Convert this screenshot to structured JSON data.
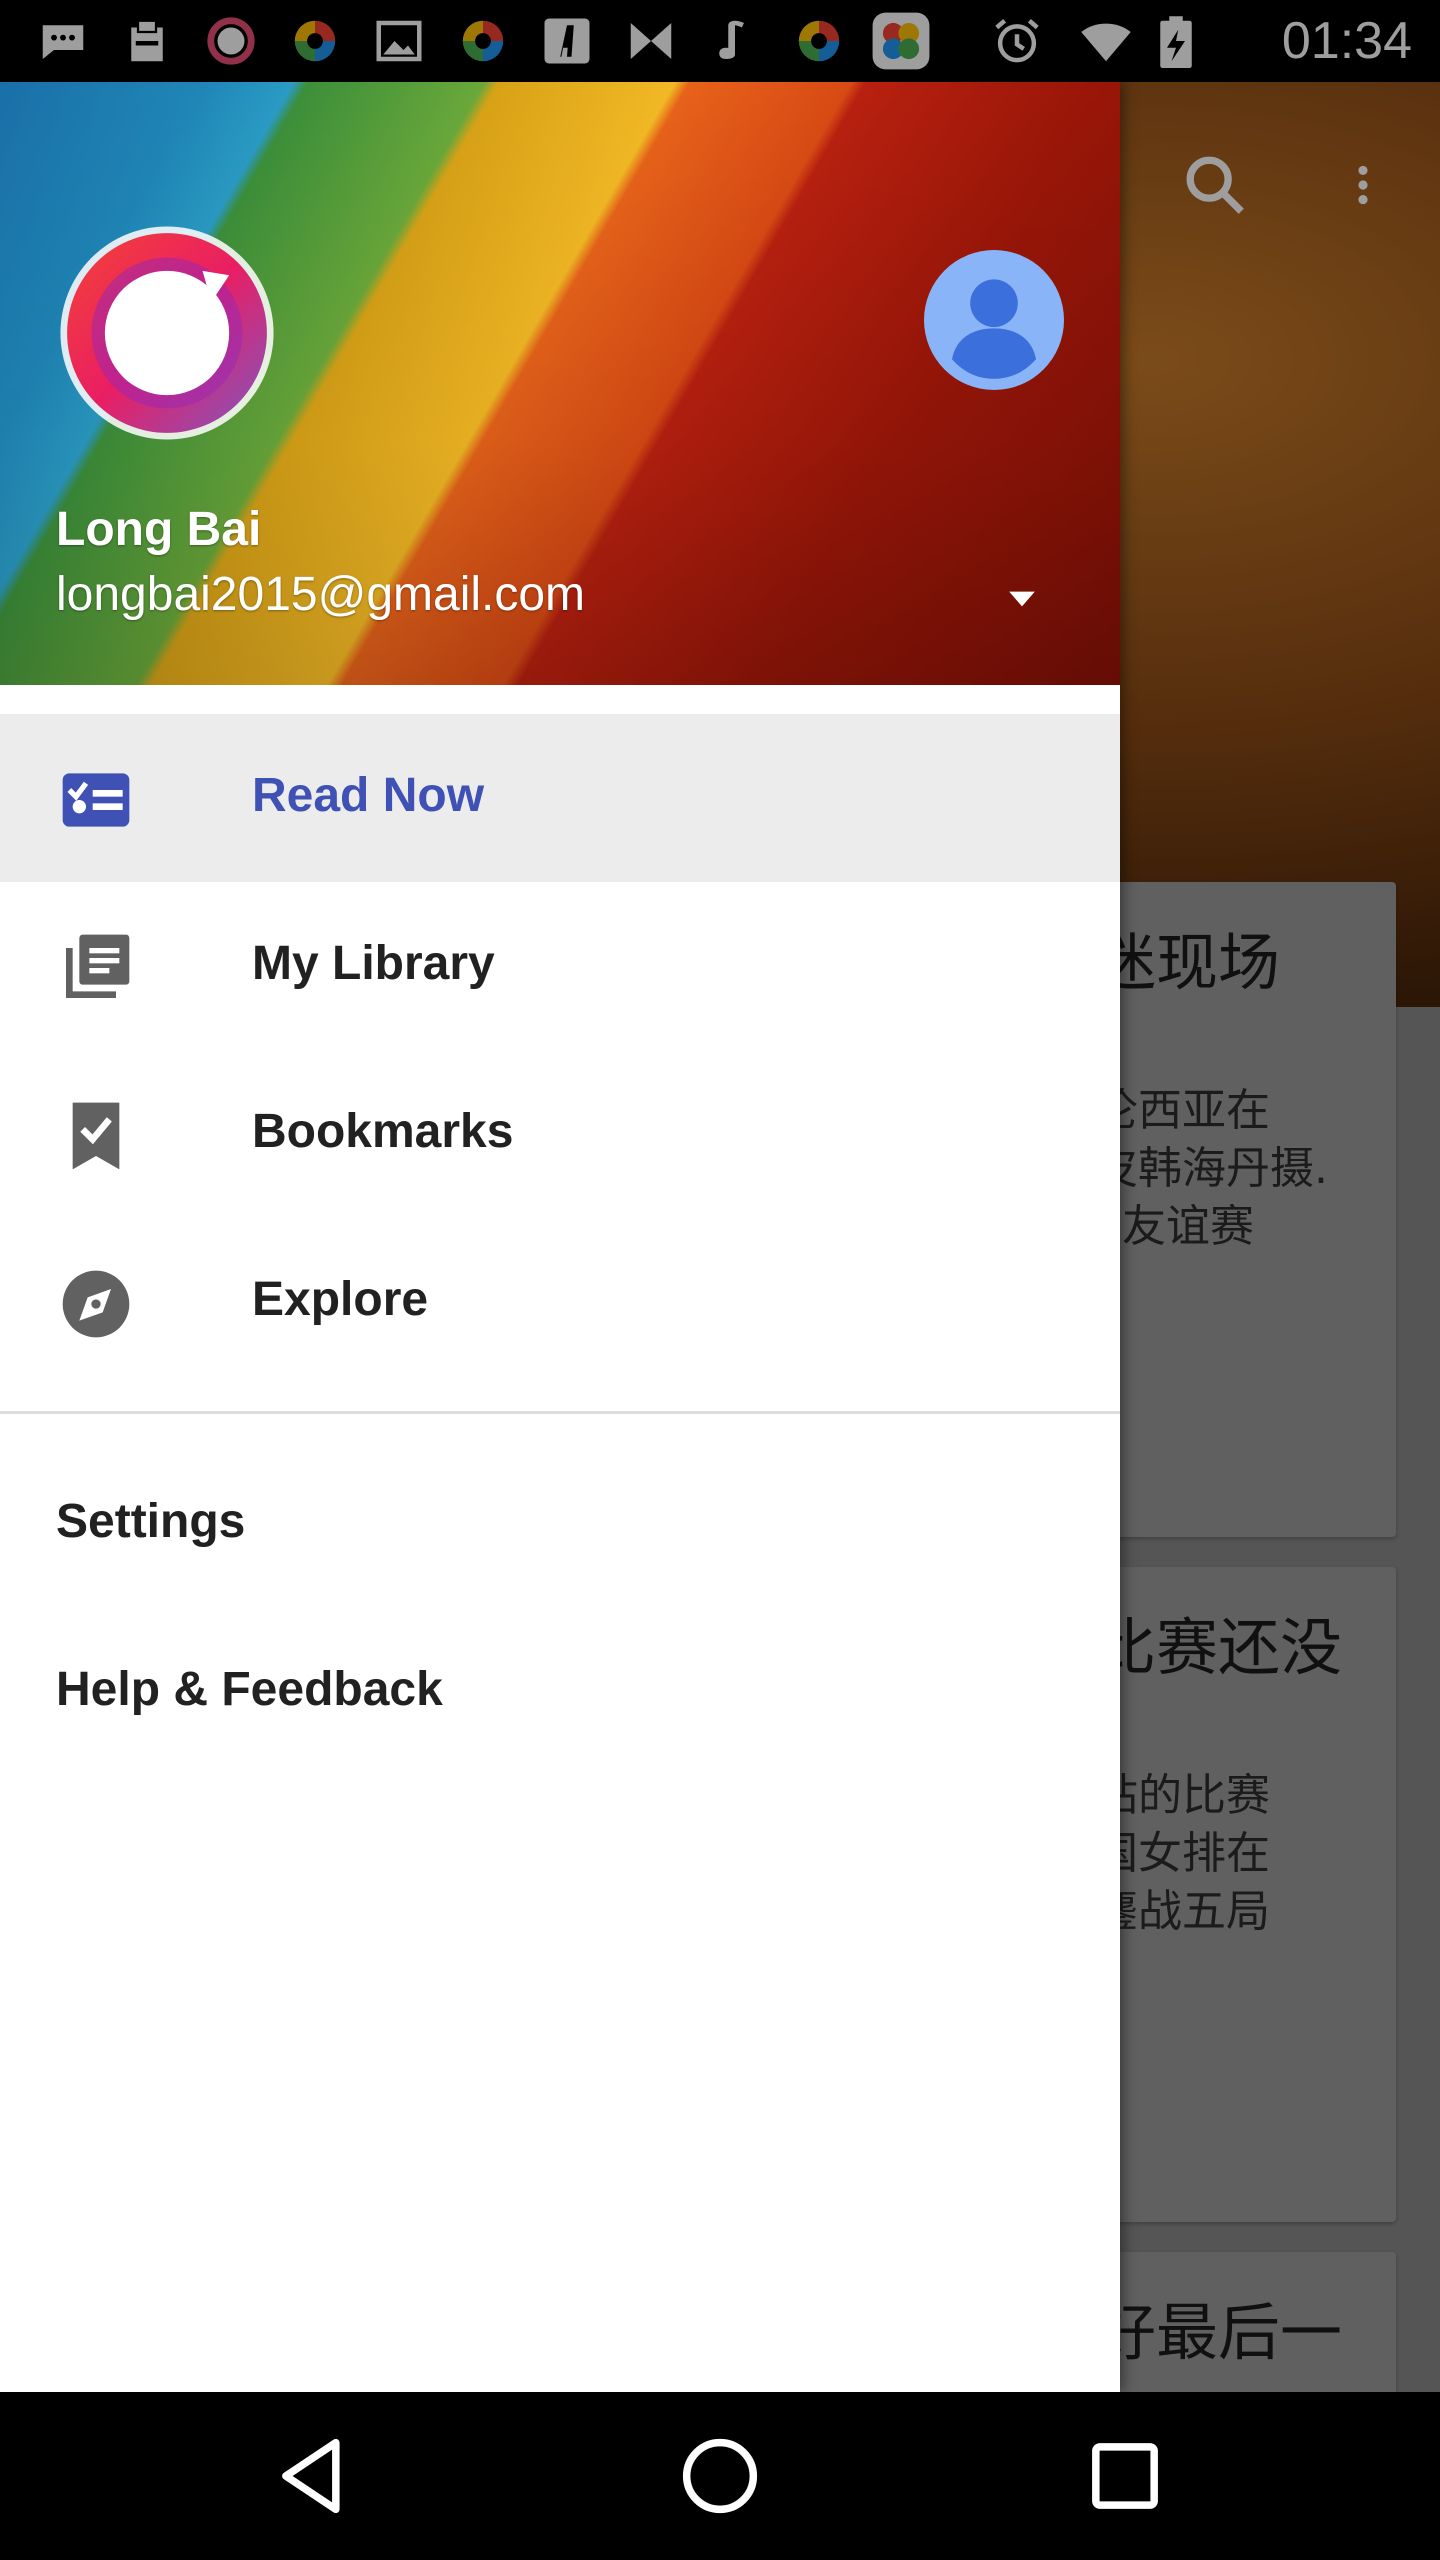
{
  "status_bar": {
    "time": "01:34",
    "notification_icons": [
      "chat-bubble-icon",
      "clipboard-icon",
      "ring-app-icon",
      "color-ball-icon",
      "image-icon",
      "color-ball-icon",
      "font-a-icon",
      "bowtie-icon",
      "music-note-icon",
      "color-ball-icon",
      "flower-app-icon"
    ],
    "system_icons": [
      "alarm-icon",
      "wifi-icon",
      "battery-icon"
    ]
  },
  "drawer": {
    "account": {
      "name": "Long Bai",
      "email": "longbai2015@gmail.com"
    },
    "nav_items": [
      {
        "label": "Read Now",
        "icon": "read-now-icon",
        "active": true
      },
      {
        "label": "My Library",
        "icon": "library-icon",
        "active": false
      },
      {
        "label": "Bookmarks",
        "icon": "bookmark-icon",
        "active": false
      },
      {
        "label": "Explore",
        "icon": "compass-icon",
        "active": false
      }
    ],
    "secondary_items": [
      {
        "label": "Settings"
      },
      {
        "label": "Help & Feedback"
      }
    ],
    "colors": {
      "accent": "#3f51b5",
      "active_bg": "#ececec",
      "text": "#212121"
    }
  },
  "background_app": {
    "cards": [
      {
        "title": "迷现场",
        "body": "伦西亚在\n皮韩海丹摄.\n. 友谊赛"
      },
      {
        "title": "比赛还没",
        "body": "站的比赛\n国女排在\n鏖战五局"
      },
      {
        "title": "好最后一",
        "body": ""
      }
    ]
  },
  "nav_bar": {
    "buttons": [
      "back-icon",
      "home-icon",
      "recents-icon"
    ]
  }
}
